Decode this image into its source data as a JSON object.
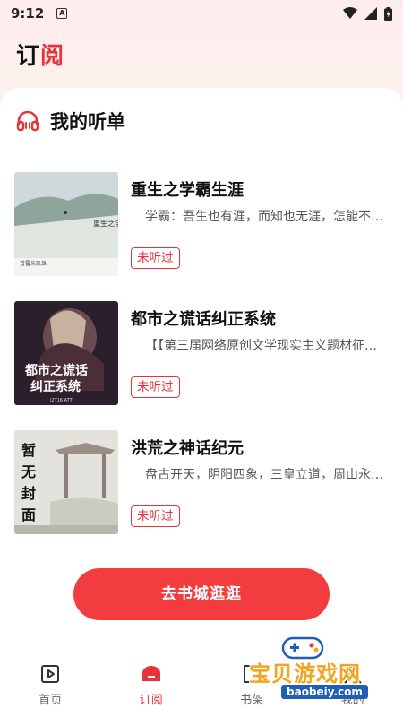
{
  "status_bar": {
    "time": "9:12",
    "notification_letter": "A"
  },
  "header": {
    "title_part1": "订",
    "title_part2": "阅"
  },
  "section": {
    "title": "我的听单"
  },
  "books": [
    {
      "title": "重生之学霸生涯",
      "desc": "学霸：吾生也有涯，而知也无涯，怎能不…",
      "status": "未听过",
      "cover_text": "重生之学霸生涯",
      "cover_author": "普雷米凯珠"
    },
    {
      "title": "都市之谎话纠正系统",
      "desc": "【【第三届网络原创文学现实主义题材征…",
      "status": "未听过",
      "cover_text_1": "都市之谎话",
      "cover_text_2": "纠正系统",
      "cover_author": "i2T16 ATT"
    },
    {
      "title": "洪荒之神话纪元",
      "desc": "盘古开天，阴阳四象，三皇立道，周山永…",
      "status": "未听过",
      "cover_text": "暂无封面"
    }
  ],
  "cta": {
    "label": "去书城逛逛"
  },
  "tabbar": {
    "items": [
      {
        "label": "首页",
        "icon": "play-square-icon"
      },
      {
        "label": "订阅",
        "icon": "subscribe-icon"
      },
      {
        "label": "书架",
        "icon": "bookshelf-icon"
      },
      {
        "label": "我的",
        "icon": "user-icon"
      }
    ]
  },
  "watermark": {
    "text": "宝贝游戏网",
    "url": "baobeiy.com"
  },
  "colors": {
    "accent": "#e8323c",
    "button": "#f23c3f"
  }
}
